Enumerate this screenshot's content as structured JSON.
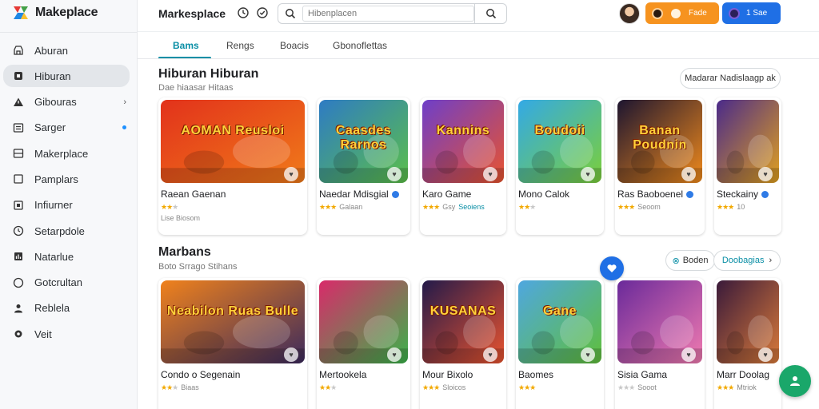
{
  "app": {
    "brand_name": "Makeplace"
  },
  "sidebar": {
    "items": [
      {
        "label": "Aburan",
        "icon": "store-icon"
      },
      {
        "label": "Hiburan",
        "icon": "gamepad-icon",
        "active": true
      },
      {
        "label": "Gibouras",
        "icon": "warning-icon",
        "chevron": true
      },
      {
        "label": "Sarger",
        "icon": "list-icon",
        "dot": true
      },
      {
        "label": "Makerplace",
        "icon": "grid-icon"
      },
      {
        "label": "Pamplars",
        "icon": "square-icon"
      },
      {
        "label": "Infiurner",
        "icon": "board-icon"
      },
      {
        "label": "Setarpdole",
        "icon": "clock-icon"
      },
      {
        "label": "Natarlue",
        "icon": "chart-icon"
      },
      {
        "label": "Gotcrultan",
        "icon": "circle-icon"
      },
      {
        "label": "Reblela",
        "icon": "person-icon"
      },
      {
        "label": "Veit",
        "icon": "gear-icon"
      }
    ]
  },
  "header": {
    "title": "Markesplace",
    "search_placeholder": "Hibenplacen",
    "orange_button_label": "Fade",
    "blue_button_label": "1 Sae"
  },
  "tabs": [
    {
      "label": "Bams",
      "active": true
    },
    {
      "label": "Rengs"
    },
    {
      "label": "Boacis"
    },
    {
      "label": "Gbonoflettas"
    }
  ],
  "section1": {
    "title": "Hiburan Hiburan",
    "subtitle": "Dae hiaasar Hitaas",
    "more_label": "Madarar Nadislaagp ak",
    "cards": [
      {
        "name": "Raean Gaenan",
        "thumb_text": "AOMAN Reusloi",
        "rating": 2,
        "meta": "",
        "extra": "Lise Biosom",
        "verified": false,
        "palette": [
          "#e2321b",
          "#f07a1a"
        ]
      },
      {
        "name": "Naedar Mdisgial",
        "thumb_text": "Caasdes Rarnos",
        "rating": 3,
        "meta": "Galaan",
        "extra": "",
        "verified": true,
        "palette": [
          "#2e7bc4",
          "#5bbf4a"
        ]
      },
      {
        "name": "Karo Game",
        "thumb_text": "Kannins",
        "rating": 3,
        "meta": "Gsy",
        "meta_accent": "Seoiens",
        "extra": "",
        "verified": false,
        "palette": [
          "#6e3fc9",
          "#e8532f"
        ]
      },
      {
        "name": "Mono Calok",
        "thumb_text": "Boudoii",
        "rating": 2,
        "meta": "",
        "extra": "",
        "verified": false,
        "palette": [
          "#33a9e6",
          "#7bcf3a"
        ]
      },
      {
        "name": "Ras Baoboenel",
        "thumb_text": "Banan Poudnin",
        "rating": 3,
        "meta": "Seoom",
        "extra": "",
        "verified": true,
        "palette": [
          "#1d1530",
          "#f08a1c"
        ]
      },
      {
        "name": "Steckainy",
        "thumb_text": "",
        "rating": 3,
        "meta": "10",
        "extra": "",
        "verified": true,
        "palette": [
          "#4a2a8a",
          "#e0a020"
        ]
      }
    ]
  },
  "section2": {
    "title": "Marbans",
    "subtitle": "Boto Srrago Stihans",
    "pill_a_label": "Boden",
    "pill_b_label": "Doobagias",
    "cards": [
      {
        "name": "Condo o Segenain",
        "thumb_text": "Neabilon Ruas Bulle",
        "rating": 2,
        "meta": "Biaas",
        "extra": "",
        "verified": false,
        "palette": [
          "#f0821c",
          "#3c2a5c"
        ]
      },
      {
        "name": "Mertookela",
        "thumb_text": "",
        "rating": 2,
        "meta": "",
        "extra": "",
        "verified": false,
        "palette": [
          "#d92a6a",
          "#3bb34a"
        ]
      },
      {
        "name": "Mour Bixolo",
        "thumb_text": "KUSANAS",
        "rating": 3,
        "meta": "Sloicos",
        "extra": "",
        "verified": false,
        "palette": [
          "#231a4a",
          "#e8532f"
        ]
      },
      {
        "name": "Baomes",
        "thumb_text": "Gane",
        "rating": 3,
        "meta": "",
        "extra": "",
        "verified": false,
        "palette": [
          "#4fa7e0",
          "#5fbf3a"
        ]
      },
      {
        "name": "Sisia Gama",
        "thumb_text": "",
        "rating": 0,
        "meta": "Sooot",
        "extra": "",
        "verified": false,
        "palette": [
          "#6a2a9a",
          "#f07ab0"
        ]
      },
      {
        "name": "Marr Doolag",
        "thumb_text": "",
        "rating": 3,
        "meta": "Mtriok",
        "extra": "",
        "verified": false,
        "palette": [
          "#3a1a3a",
          "#d97a3a"
        ]
      }
    ]
  },
  "colors": {
    "accent": "#0b8fa6",
    "fab": "#1aa76a",
    "orange": "#f6931f",
    "blue": "#1f6fe5"
  }
}
